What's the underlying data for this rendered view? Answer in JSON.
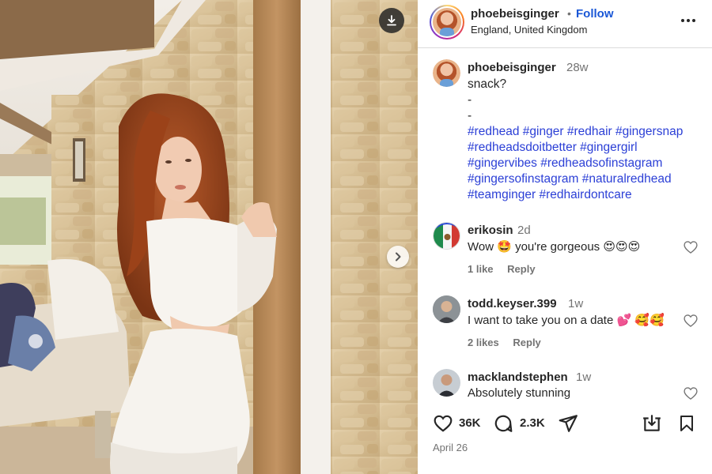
{
  "post": {
    "username": "phoebeisginger",
    "separator": "•",
    "follow_label": "Follow",
    "location": "England, United Kingdom",
    "more_icon": "more-horizontal-icon",
    "download_icon": "download-icon",
    "next_icon": "chevron-right-icon"
  },
  "caption": {
    "username": "phoebeisginger",
    "time": "28w",
    "lines": [
      "snack?",
      "-",
      "-"
    ],
    "hashtag_lines": [
      "#redhead #ginger #redhair #gingersnap",
      "#redheadsdoitbetter #gingergirl",
      "#gingervibes #redheadsofinstagram",
      "#gingersofinstagram #naturalredhead",
      "#teamginger #redhairdontcare"
    ]
  },
  "comments": [
    {
      "username": "erikosin",
      "time": "2d",
      "text": "Wow 🤩 you're gorgeous 😍😍😍",
      "likes": "1 like",
      "reply": "Reply"
    },
    {
      "username": "todd.keyser.399",
      "time": "1w",
      "text": "I want to take you on a date 💕 🥰🥰",
      "likes": "2 likes",
      "reply": "Reply"
    },
    {
      "username": "macklandstephen",
      "time": "1w",
      "text": "Absolutely stunning",
      "likes": "",
      "reply": ""
    }
  ],
  "actions": {
    "likes_count": "36K",
    "comments_count": "2.3K",
    "date": "April 26"
  },
  "colors": {
    "link_blue": "#2b3fd6",
    "follow_blue": "#1a57d6",
    "muted_gray": "#737373",
    "text": "#262626"
  }
}
